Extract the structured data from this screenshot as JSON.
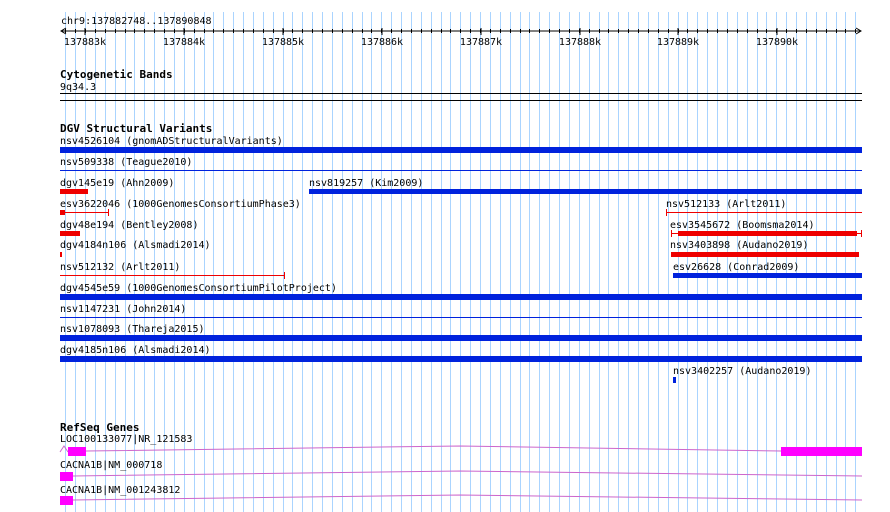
{
  "ruler": {
    "region": "chr9:137882748..137890848",
    "ticks": [
      "137883k",
      "137884k",
      "137885k",
      "137886k",
      "137887k",
      "137888k",
      "137889k",
      "137890k"
    ]
  },
  "cyto": {
    "title": "Cytogenetic Bands",
    "band": "9q34.3"
  },
  "dgv": {
    "title": "DGV Structural Variants",
    "items": [
      "nsv4526104 (gnomADStructuralVariants)",
      "nsv509338 (Teague2010)",
      "dgv145e19 (Ahn2009)",
      "nsv819257 (Kim2009)",
      "esv3622046 (1000GenomesConsortiumPhase3)",
      "nsv512133 (Arlt2011)",
      "dgv48e194 (Bentley2008)",
      "esv3545672 (Boomsma2014)",
      "dgv4184n106 (Alsmadi2014)",
      "nsv3403898 (Audano2019)",
      "nsv512132 (Arlt2011)",
      "esv26628 (Conrad2009)",
      "dgv4545e59 (1000GenomesConsortiumPilotProject)",
      "nsv1147231 (John2014)",
      "nsv1078093 (Thareja2015)",
      "dgv4185n106 (Alsmadi2014)",
      "nsv3402257 (Audano2019)"
    ]
  },
  "refseq": {
    "title": "RefSeq Genes",
    "genes": [
      "LOC100133077|NR_121583",
      "CACNA1B|NM_000718",
      "CACNA1B|NM_001243812"
    ]
  },
  "colors": {
    "grid": "#aad4ff",
    "blue": "#0022dd",
    "red": "#ee0000",
    "magenta": "#ff00ff",
    "gene_line": "#cc66cc"
  }
}
